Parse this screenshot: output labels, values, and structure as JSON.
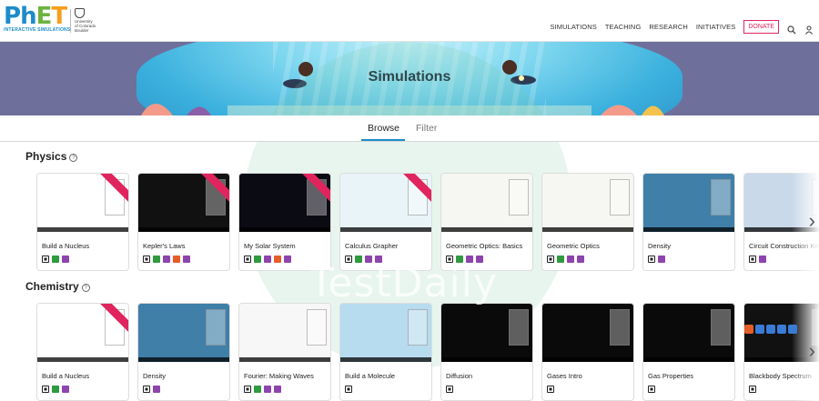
{
  "header": {
    "logo_main": "PhET",
    "logo_sub": "INTERACTIVE SIMULATIONS",
    "university": [
      "University",
      "of Colorado",
      "Boulder"
    ],
    "nav": [
      "SIMULATIONS",
      "TEACHING",
      "RESEARCH",
      "INITIATIVES"
    ],
    "donate": "DONATE"
  },
  "banner": {
    "title": "Simulations"
  },
  "tabs": {
    "browse": "Browse",
    "filter": "Filter"
  },
  "watermark": "TestDaily",
  "sections": [
    {
      "title": "Physics",
      "cards": [
        {
          "title": "Build a Nucleus",
          "thumb": "#ffffff",
          "ribbon": true,
          "badges": [
            "dark",
            "green",
            "purple"
          ]
        },
        {
          "title": "Kepler's Laws",
          "thumb": "#111111",
          "ribbon": true,
          "badges": [
            "dark",
            "green",
            "purple",
            "orange",
            "purple"
          ]
        },
        {
          "title": "My Solar System",
          "thumb": "#0b0b14",
          "ribbon": true,
          "badges": [
            "dark",
            "green",
            "purple",
            "orange",
            "purple"
          ]
        },
        {
          "title": "Calculus Grapher",
          "thumb": "#e9f4f8",
          "ribbon": true,
          "badges": [
            "dark",
            "green",
            "purple",
            "purple"
          ]
        },
        {
          "title": "Geometric Optics: Basics",
          "thumb": "#f6f6f2",
          "ribbon": false,
          "badges": [
            "dark",
            "green",
            "purple",
            "purple"
          ]
        },
        {
          "title": "Geometric Optics",
          "thumb": "#f6f6f2",
          "ribbon": false,
          "badges": [
            "dark",
            "green",
            "purple",
            "purple"
          ]
        },
        {
          "title": "Density",
          "thumb": "#3f7fa8",
          "ribbon": false,
          "badges": [
            "dark",
            "purple"
          ]
        },
        {
          "title": "Circuit Construction Kit: AC",
          "thumb": "#c9d9ea",
          "ribbon": false,
          "badges": [
            "dark",
            "purple"
          ]
        }
      ]
    },
    {
      "title": "Chemistry",
      "cards": [
        {
          "title": "Build a Nucleus",
          "thumb": "#ffffff",
          "ribbon": true,
          "badges": [
            "dark",
            "green",
            "purple"
          ]
        },
        {
          "title": "Density",
          "thumb": "#3f7fa8",
          "ribbon": false,
          "badges": [
            "dark",
            "purple"
          ]
        },
        {
          "title": "Fourier: Making Waves",
          "thumb": "#f7f7f7",
          "ribbon": false,
          "badges": [
            "dark",
            "green",
            "purple",
            "purple"
          ]
        },
        {
          "title": "Build a Molecule",
          "thumb": "#b7dbef",
          "ribbon": false,
          "badges": [
            "dark"
          ]
        },
        {
          "title": "Diffusion",
          "thumb": "#0a0a0a",
          "ribbon": false,
          "badges": [
            "dark"
          ]
        },
        {
          "title": "Gases Intro",
          "thumb": "#0a0a0a",
          "ribbon": false,
          "badges": [
            "dark"
          ]
        },
        {
          "title": "Gas Properties",
          "thumb": "#0a0a0a",
          "ribbon": false,
          "badges": [
            "dark"
          ]
        },
        {
          "title": "Blackbody Spectrum",
          "thumb": "#111111",
          "ribbon": false,
          "badges": [
            "dark"
          ]
        }
      ]
    }
  ]
}
